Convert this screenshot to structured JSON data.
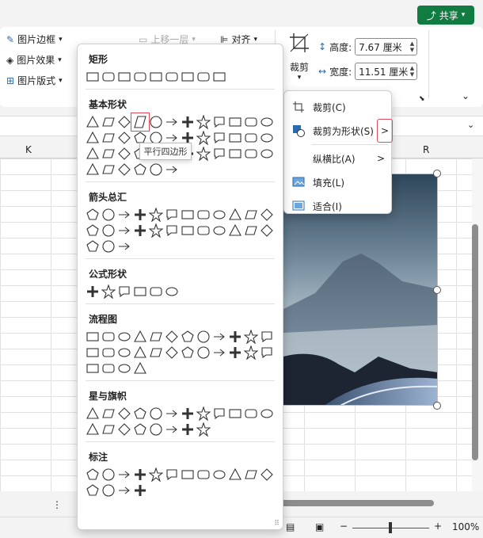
{
  "header": {
    "share_label": "共享"
  },
  "ribbon": {
    "picture_border": "图片边框",
    "picture_effects": "图片效果",
    "picture_layout": "图片版式",
    "bring_forward": "上移一层",
    "align": "对齐",
    "crop": "裁剪",
    "height_label": "高度:",
    "height_value": "7.67 厘米",
    "width_label": "宽度:",
    "width_value": "11.51 厘米"
  },
  "columns": {
    "k": "K",
    "r": "R"
  },
  "shapes_panel": {
    "sections": [
      {
        "title": "矩形",
        "count": 9
      },
      {
        "title": "基本形状",
        "count": 42
      },
      {
        "title": "箭头总汇",
        "count": 27
      },
      {
        "title": "公式形状",
        "count": 6
      },
      {
        "title": "流程图",
        "count": 28
      },
      {
        "title": "星与旗帜",
        "count": 20
      },
      {
        "title": "标注",
        "count": 16
      }
    ]
  },
  "tooltip": "平行四边形",
  "crop_menu": {
    "items": [
      {
        "label": "裁剪(C)",
        "has_submenu": false
      },
      {
        "label": "裁剪为形状(S)",
        "has_submenu": true
      },
      {
        "label": "纵横比(A)",
        "has_submenu": true
      },
      {
        "label": "填充(L)",
        "has_submenu": false
      },
      {
        "label": "适合(I)",
        "has_submenu": false
      }
    ]
  },
  "status": {
    "zoom": "100%"
  }
}
